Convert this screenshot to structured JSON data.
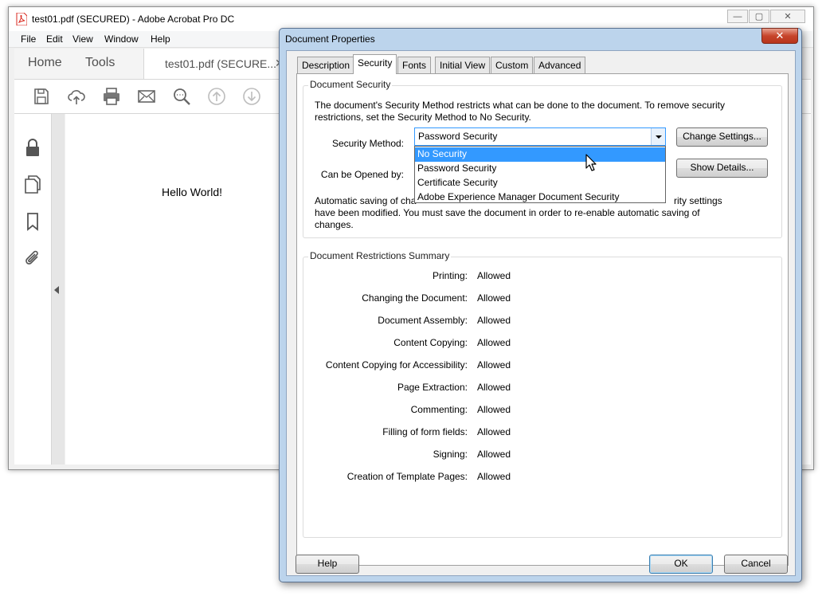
{
  "app": {
    "title": "test01.pdf (SECURED) - Adobe Acrobat Pro DC",
    "window_controls": {
      "minimize": "—",
      "maximize": "▢",
      "close": "✕"
    },
    "menu": [
      "File",
      "Edit",
      "View",
      "Window",
      "Help"
    ],
    "nav_tabs": [
      "Home",
      "Tools"
    ],
    "doc_tab": {
      "label": "test01.pdf (SECURE...",
      "close": "✕"
    },
    "toolbar_icons": [
      "save-icon",
      "upload-cloud-icon",
      "print-icon",
      "email-icon",
      "search-zoom-icon",
      "page-up-icon",
      "page-down-icon"
    ],
    "rail_icons": [
      "lock-icon",
      "pages-icon",
      "bookmark-icon",
      "paperclip-icon"
    ],
    "document_text": "Hello World!"
  },
  "dialog": {
    "title": "Document Properties",
    "close": "✕",
    "tabs": [
      "Description",
      "Security",
      "Fonts",
      "Initial View",
      "Custom",
      "Advanced"
    ],
    "active_tab": "Security",
    "security": {
      "legend": "Document Security",
      "intro_line1": "The document's Security Method restricts what can be done to the document. To remove security",
      "intro_line2": "restrictions, set the Security Method to No Security.",
      "method_label": "Security Method:",
      "method_value": "Password Security",
      "options": [
        "No Security",
        "Password Security",
        "Certificate Security",
        "Adobe Experience Manager Document Security"
      ],
      "highlighted_option": "No Security",
      "change_settings": "Change Settings...",
      "opened_by_label": "Can be Opened by:",
      "show_details": "Show Details...",
      "auto_save_line1_start": "Automatic saving of cha",
      "auto_save_line1_end": "rity settings",
      "auto_save_line2": "have been modified. You must save the document in order to re-enable automatic saving of",
      "auto_save_line3": "changes."
    },
    "restrictions": {
      "legend": "Document Restrictions Summary",
      "rows": [
        {
          "label": "Printing:",
          "value": "Allowed"
        },
        {
          "label": "Changing the Document:",
          "value": "Allowed"
        },
        {
          "label": "Document Assembly:",
          "value": "Allowed"
        },
        {
          "label": "Content Copying:",
          "value": "Allowed"
        },
        {
          "label": "Content Copying for Accessibility:",
          "value": "Allowed"
        },
        {
          "label": "Page Extraction:",
          "value": "Allowed"
        },
        {
          "label": "Commenting:",
          "value": "Allowed"
        },
        {
          "label": "Filling of form fields:",
          "value": "Allowed"
        },
        {
          "label": "Signing:",
          "value": "Allowed"
        },
        {
          "label": "Creation of Template Pages:",
          "value": "Allowed"
        }
      ]
    },
    "buttons": {
      "help": "Help",
      "ok": "OK",
      "cancel": "Cancel"
    }
  },
  "colors": {
    "selection": "#3399ff",
    "dialog_frame": "#bcd4ec",
    "close_button": "#c7452c",
    "acrobat_red": "#d9261c"
  }
}
